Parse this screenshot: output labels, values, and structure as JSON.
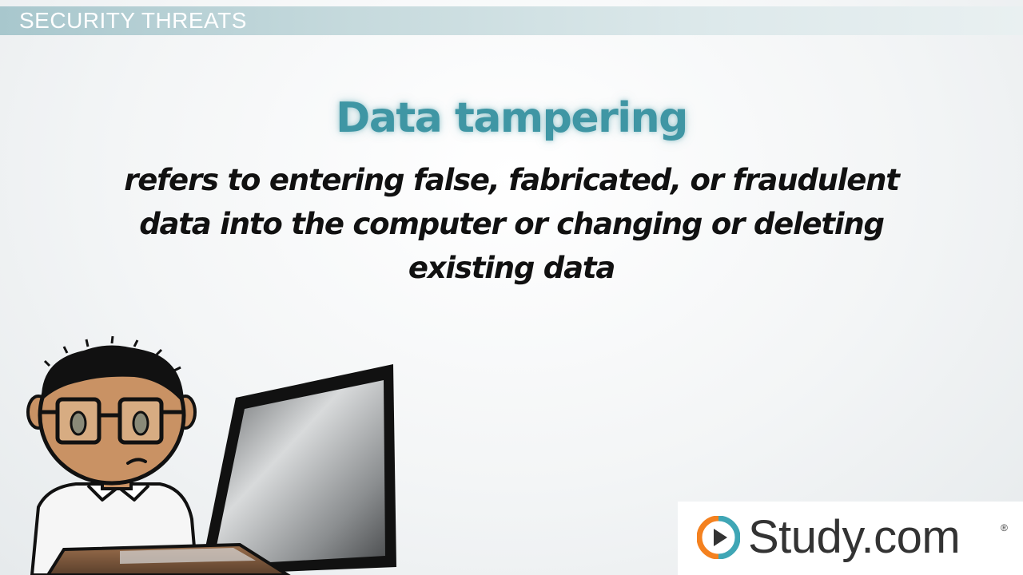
{
  "header": {
    "title": "SECURITY THREATS"
  },
  "slide": {
    "term": "Data tampering",
    "definition": "refers to entering false, fabricated, or fraudulent data into the computer or changing or deleting existing data"
  },
  "illustration": {
    "character_icon": "person-at-laptop-icon"
  },
  "logo": {
    "text": "Study.com",
    "registered_mark": "®",
    "icon": "play-circle-icon",
    "colors": {
      "orange": "#f4811f",
      "teal": "#3fa6b5",
      "text": "#333333"
    }
  },
  "colors": {
    "accent_teal": "#3f96a4",
    "header_bar": "#a8c7cd"
  }
}
